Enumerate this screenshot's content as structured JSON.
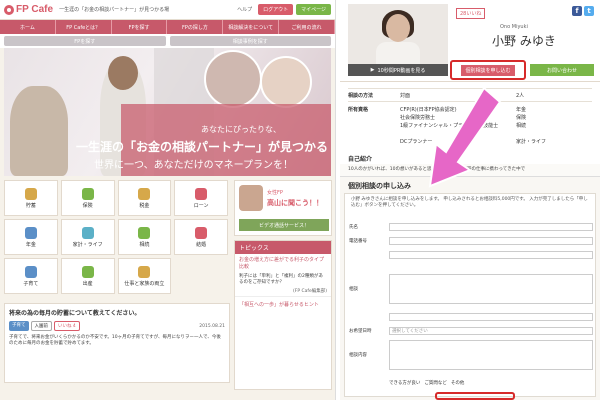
{
  "left": {
    "logo": "FP Cafe",
    "tagline": "一生涯の「お金の相談パートナー」が見つかる場",
    "help": "ヘルプ",
    "login": "ログアウト",
    "mypage": "マイページ",
    "nav": [
      "ホーム",
      "FP Cafeとは？",
      "FPを探す",
      "FPの探し方",
      "相談解決をについて",
      "ご利用の流れ"
    ],
    "search_fp": "FPを探す",
    "search_case": "相談事例を探す",
    "hero": {
      "line1": "あなたにぴったりな、",
      "line2": "一生涯の「お金の相談パートナー」が見つかる",
      "line3": "世界に一つ、あなただけのマネープランを！"
    },
    "categories": [
      {
        "label": "貯蓄",
        "color": "#d6a84a"
      },
      {
        "label": "保険",
        "color": "#7ab648"
      },
      {
        "label": "税金",
        "color": "#d6a84a"
      },
      {
        "label": "ローン",
        "color": "#d85c6a"
      },
      {
        "label": "年金",
        "color": "#5b8fc7"
      },
      {
        "label": "家計・ライフ",
        "color": "#5bb0c7"
      },
      {
        "label": "相続",
        "color": "#7ab648"
      },
      {
        "label": "結婚",
        "color": "#d85c6a"
      },
      {
        "label": "子育て",
        "color": "#5b8fc7"
      },
      {
        "label": "出産",
        "color": "#7ab648"
      },
      {
        "label": "仕事と家族の両立",
        "color": "#d6a84a"
      }
    ],
    "ad": {
      "small": "女性FP",
      "big": "高山に聞こう！！",
      "bar": "ビデオ通話サービス！"
    },
    "topics": {
      "header": "トピックス",
      "title": "お金の増え方に差がでる利子のタイプ比較",
      "body": "利子には「単利」と「複利」の2種類があるのをご存知ですか？",
      "footer": "(FP Cafe編集部)",
      "link": "「相互への一歩」が暮らせるヒント"
    },
    "question": {
      "title": "将来の為の毎月の貯蓄について教えてください。",
      "tags": [
        "子育て",
        "入園前",
        "いいね 4"
      ],
      "date": "2015.08.21",
      "body": "子育てで、将来お金がいくらかかるのか不安です。10ヶ月の子育てですが、毎月になりヲー一人で、今後のために毎月のお金を貯蓄で貯めてます。"
    }
  },
  "right": {
    "likes": "28いいね",
    "romaji": "Ono Miyuki",
    "name": "小野 みゆき",
    "btn_video": "10秒間PR動画を見る",
    "btn_consult": "個別相談を申し込む",
    "btn_contact": "お問い合わせ",
    "fields": [
      {
        "k": "相談の方法",
        "v": "対面",
        "v2": "2人"
      },
      {
        "k": "所有資格",
        "v": "CFP(R)(日本FP協会認定)",
        "v2": "年金"
      },
      {
        "k": "",
        "v": "社会保険労務士",
        "v2": "保険"
      },
      {
        "k": "",
        "v": "1級ファイナンシャル・プランニング技能士",
        "v2": "相続"
      },
      {
        "k": "",
        "v": "DCプランナー",
        "v2": "家計・ライフ"
      }
    ],
    "self_intro": "自己紹介",
    "intro_text": "10人のかがいれば、10の想いがあると思います。ずっと保険の仕事に携わってきた中で",
    "form": {
      "title": "個別相談の申し込み",
      "intro": "小野 みゆきさんに相談を申し込みをします。 申し込みされるとお相談料5,000円です。 入力が完了しましたら「申し込む」ボタンを押してください。",
      "labels": [
        "氏名",
        "電話番号",
        "",
        "相談",
        "",
        "お希望日時",
        "相談内容"
      ],
      "select_placeholder": "選択してください",
      "radios": [
        "できる方が良い",
        "ご質問など",
        "その他"
      ]
    }
  }
}
